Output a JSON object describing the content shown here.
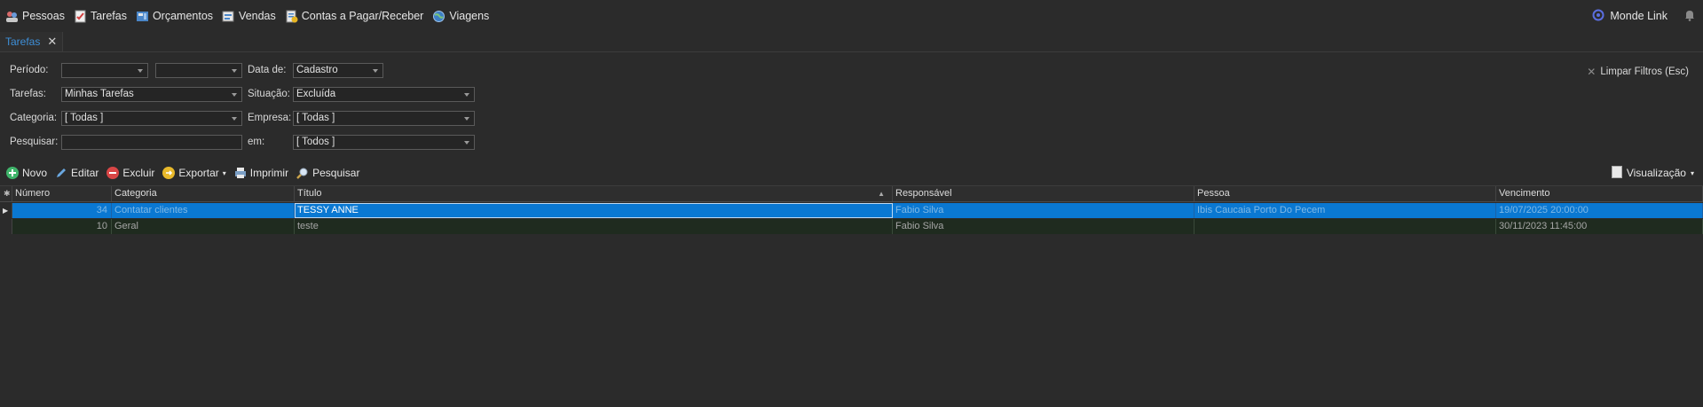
{
  "menu": {
    "items": [
      {
        "label": "Pessoas",
        "icon": "people-icon"
      },
      {
        "label": "Tarefas",
        "icon": "tasks-checklist-icon"
      },
      {
        "label": "Orçamentos",
        "icon": "quote-calculator-icon"
      },
      {
        "label": "Vendas",
        "icon": "sales-icon"
      },
      {
        "label": "Contas a Pagar/Receber",
        "icon": "bills-icon"
      },
      {
        "label": "Viagens",
        "icon": "globe-travel-icon"
      }
    ],
    "monde_link": "Monde Link"
  },
  "tabs": [
    {
      "label": "Tarefas"
    }
  ],
  "filters": {
    "periodo_label": "Período:",
    "periodo_start": "",
    "periodo_end": "",
    "data_de_label": "Data de:",
    "data_de_value": "Cadastro",
    "tarefas_label": "Tarefas:",
    "tarefas_value": "Minhas Tarefas",
    "situacao_label": "Situação:",
    "situacao_value": "Excluída",
    "categoria_label": "Categoria:",
    "categoria_value": "[ Todas ]",
    "empresa_label": "Empresa:",
    "empresa_value": "[ Todas ]",
    "pesquisar_label": "Pesquisar:",
    "pesquisar_value": "",
    "em_label": "em:",
    "em_value": "[ Todos ]",
    "clear_label": "Limpar Filtros (Esc)"
  },
  "toolbar": {
    "novo": "Novo",
    "editar": "Editar",
    "excluir": "Excluir",
    "exportar": "Exportar",
    "imprimir": "Imprimir",
    "pesquisar": "Pesquisar",
    "visualizacao": "Visualização"
  },
  "grid": {
    "columns": [
      "Número",
      "Categoria",
      "Título",
      "Responsável",
      "Pessoa",
      "Vencimento"
    ],
    "rows": [
      {
        "numero": "34",
        "categoria": "Contatar clientes",
        "titulo": "TESSY ANNE",
        "responsavel": "Fabio Silva",
        "pessoa": "Ibis Caucaia Porto Do Pecem",
        "vencimento": "19/07/2025 20:00:00"
      },
      {
        "numero": "10",
        "categoria": "Geral",
        "titulo": "teste",
        "responsavel": "Fabio Silva",
        "pessoa": "",
        "vencimento": "30/11/2023 11:45:00"
      }
    ]
  },
  "colors": {
    "accent": "#0a78d2",
    "tab_text": "#3e8fd8",
    "background": "#2b2b2b"
  }
}
